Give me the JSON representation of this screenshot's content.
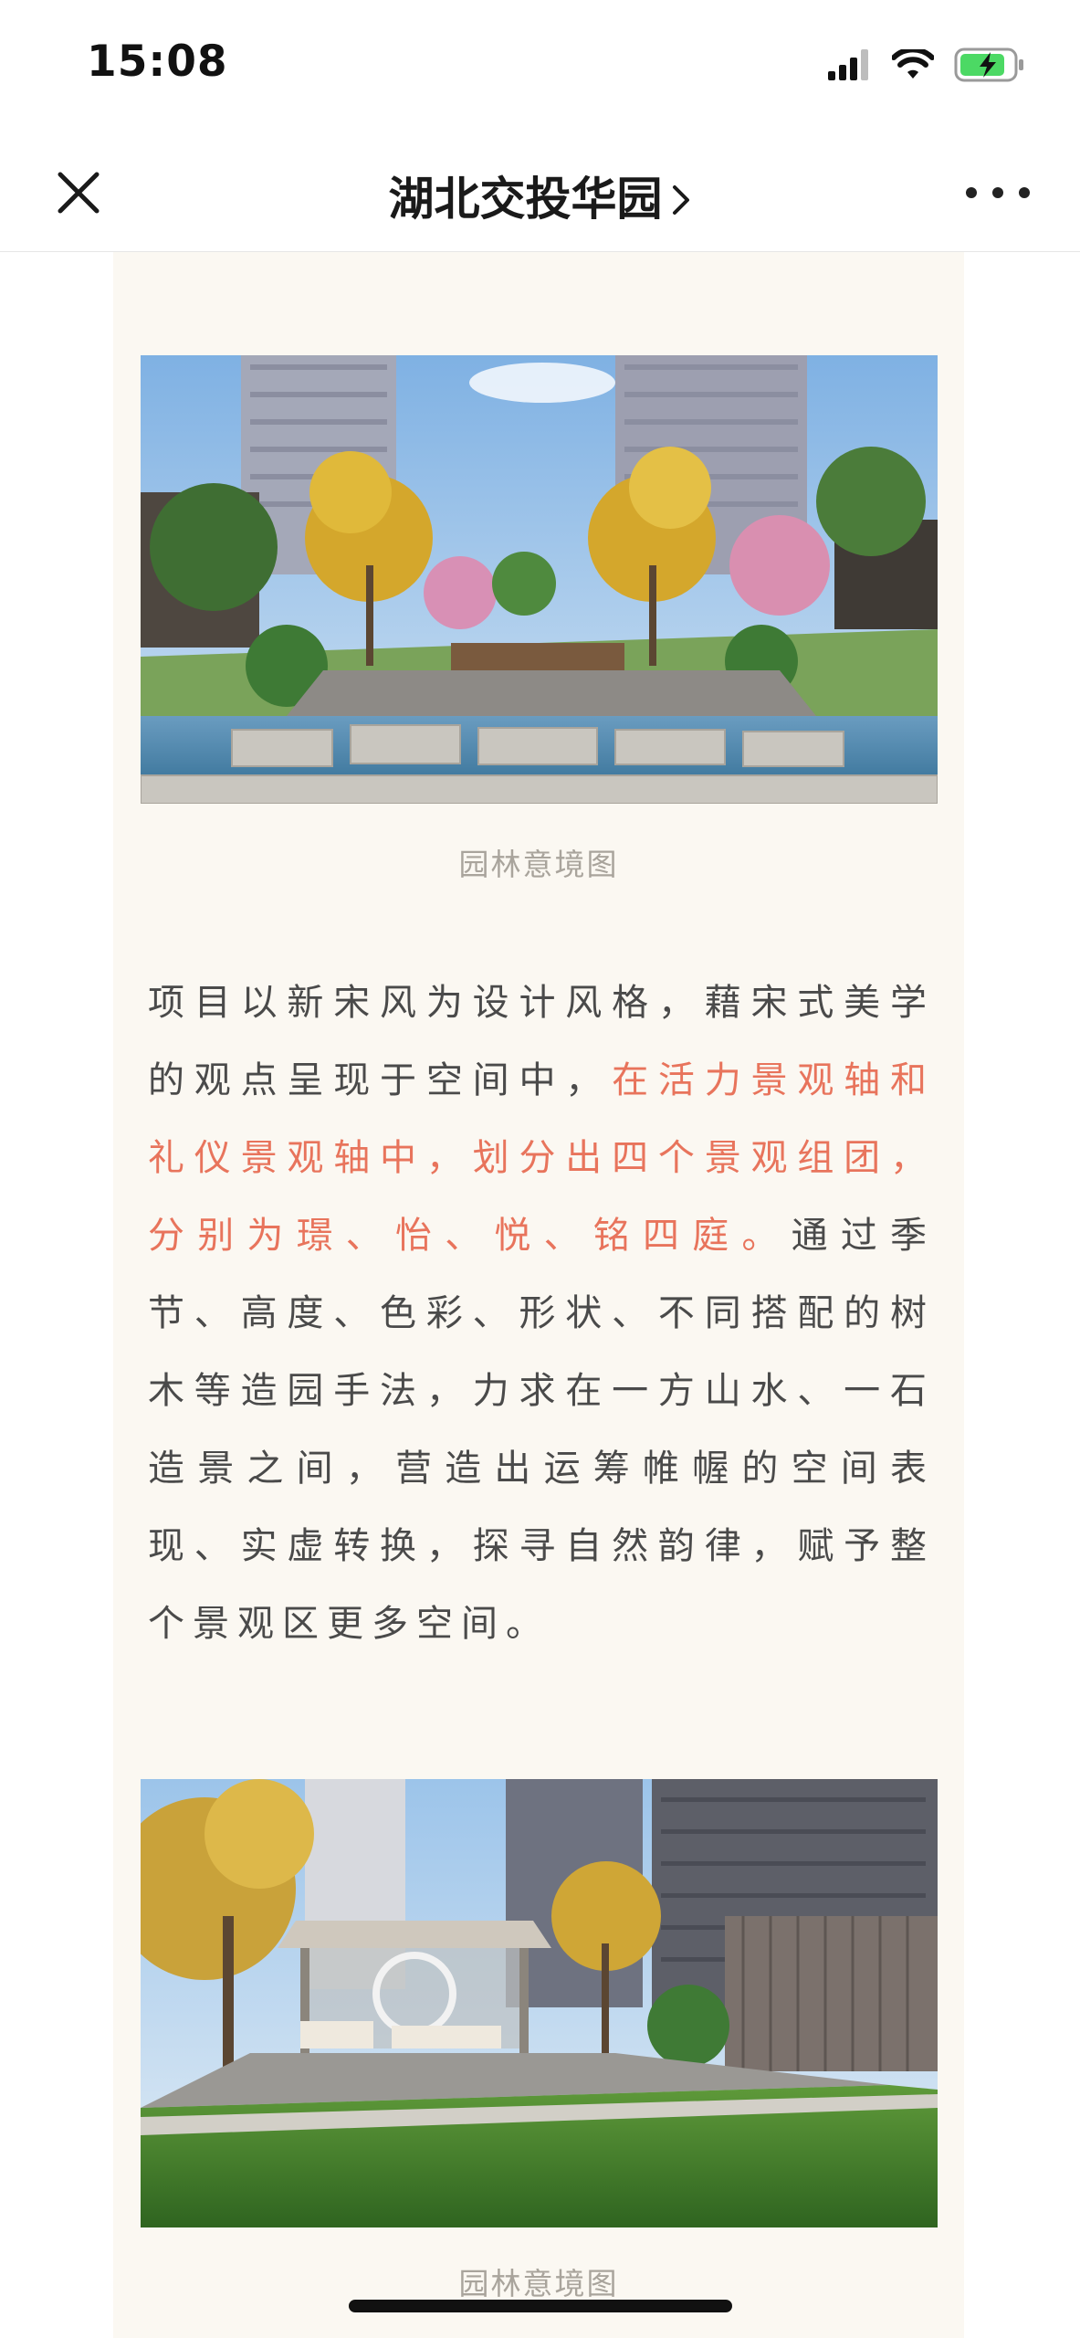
{
  "status_bar": {
    "time": "15:08"
  },
  "nav": {
    "title": "湖北交投华园",
    "icons": [
      "close-icon",
      "chevron-right-icon",
      "more-icon"
    ]
  },
  "article": {
    "caption_1": "园林意境图",
    "paragraph": {
      "part1": "项目以新宋风为设计风格，藉宋式美学的观点呈现于空间中，",
      "highlight": "在活力景观轴和礼仪景观轴中，划分出四个景观组团，分别为璟、怡、悦、铭四庭。",
      "part2": "通过季节、高度、色彩、形状、不同搭配的树木等造园手法，力求在一方山水、一石造景之间，营造出运筹帷幄的空间表现、实虚转换，探寻自然韵律，赋予整个景观区更多空间。"
    },
    "caption_2": "园林意境图"
  },
  "colors": {
    "article_bg": "#fbf8f2",
    "highlight": "#e8745c",
    "body_text": "#4a4a4a",
    "caption": "#a9a49c"
  }
}
